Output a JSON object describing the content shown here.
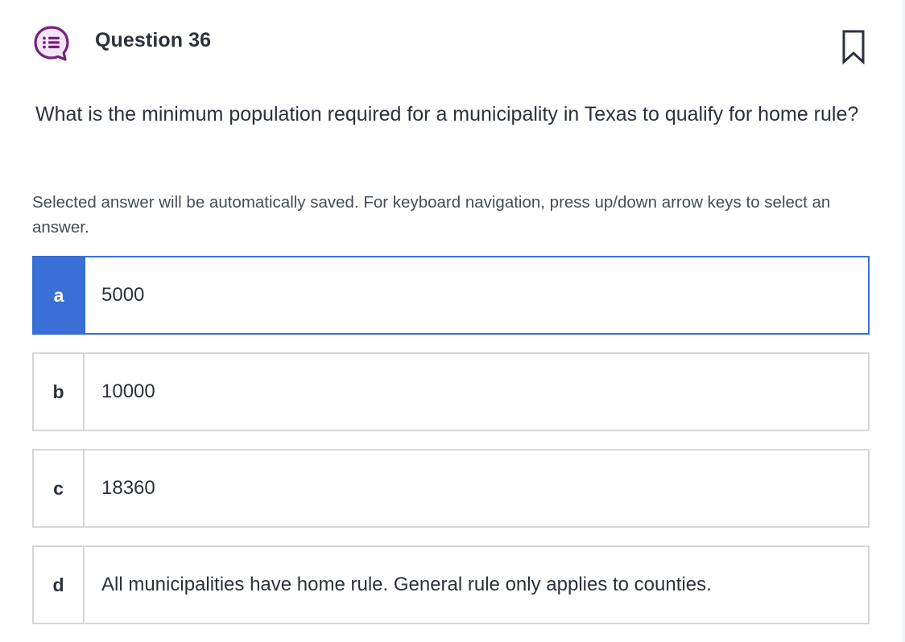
{
  "header": {
    "title": "Question 36",
    "icon": "question-list-icon",
    "bookmark_icon": "bookmark-icon"
  },
  "question": {
    "text": "What is the minimum population required for a municipality in Texas to qualify for home rule?"
  },
  "instructions": "Selected answer will be automatically saved. For keyboard navigation, press up/down arrow keys to select an answer.",
  "options": [
    {
      "letter": "a",
      "text": "5000",
      "selected": true
    },
    {
      "letter": "b",
      "text": "10000",
      "selected": false
    },
    {
      "letter": "c",
      "text": "18360",
      "selected": false
    },
    {
      "letter": "d",
      "text": "All municipalities have home rule. General rule only applies to counties.",
      "selected": false
    }
  ],
  "colors": {
    "accent": "#3a6fd8",
    "icon_purple": "#7a1f7e",
    "icon_fill": "#f3e6f4",
    "border": "#d4d7db",
    "text": "#2b323c"
  }
}
